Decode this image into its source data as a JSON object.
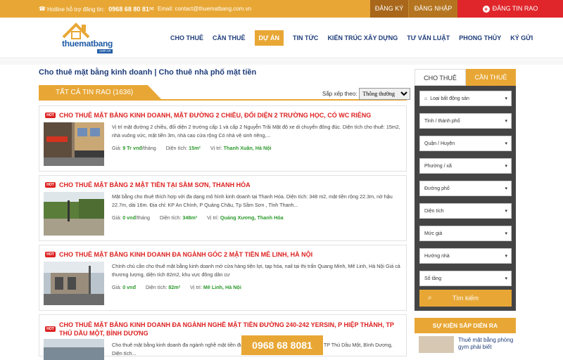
{
  "topbar": {
    "hotline_label": "Hotline hỗ trợ đăng tin:",
    "hotline_number": "0968 68 80 81",
    "email_label": "Email: contact@thuematbang.com.vn",
    "register": "ĐĂNG KÝ",
    "login": "ĐĂNG NHẬP",
    "post": "ĐĂNG TIN RAO"
  },
  "logo": {
    "word": "thuematbang",
    "domain": ".com.vn"
  },
  "nav": {
    "items": [
      "CHO THUÊ",
      "CẦN THUÊ",
      "DỰ ÁN",
      "TIN TỨC",
      "KIẾN TRÚC XÂY DỰNG",
      "TƯ VẤN LUẬT",
      "PHONG THỦY",
      "KÝ GỬI"
    ],
    "active_index": 2
  },
  "page": {
    "breadcrumb": "Cho thuê mặt bằng kinh doanh | Cho thuê nhà phố mặt tiền",
    "list_title": "TẤT CẢ TIN RAO (1636)",
    "sort_label": "Sắp xếp theo:",
    "sort_value": "Thông thường"
  },
  "listings": [
    {
      "title": "CHO THUÊ MẶT BẰNG KINH DOANH, MẶT ĐƯỜNG 2 CHIỀU, ĐỐI DIỆN 2 TRƯỜNG HỌC, CÓ WC RIÊNG",
      "desc": "Vị trí mặt đường 2 chiều, đối diện 2 trường cấp 1 và cấp 2 Nguyễn Trãi Mặt độ xe di chuyển đông đúc. Diện tích cho thuê: 15m2, nhà vuông vức, mặt tiền 3m, nhà cao cửa rộng Có nhà vệ sinh riêng,...",
      "price_label": "Giá:",
      "price": "9 Tr vnđ",
      "price_unit": "/tháng",
      "area_label": "Diện tích:",
      "area": "15m²",
      "loc_label": "Vị trí:",
      "loc": "Thanh Xuân, Hà Nội"
    },
    {
      "title": "CHO THUÊ MẶT BẰNG 2 MẶT TIỀN TẠI SẦM SƠN, THANH HÓA",
      "desc": "Mặt bằng cho thuê thích hợp với đa dạng mô hình kinh doanh tại Thanh Hóa. Diện tích: 348 m2, mặt tiền rộng 22.3m, nở hậu 22.7m, dài 16m. Địa chỉ: KP An Chính, P Quảng Châu, Tp Sầm Sơn , Tỉnh Thanh...",
      "price_label": "Giá:",
      "price": "0 vnđ",
      "price_unit": "/tháng",
      "area_label": "Diện tích:",
      "area": "348m²",
      "loc_label": "Vị trí:",
      "loc": "Quảng Xương, Thanh Hóa"
    },
    {
      "title": "CHO THUÊ MẶT BẰNG KINH DOANH ĐA NGÀNH GÓC 2 MẶT TIỀN MÊ LINH, HÀ NỘI",
      "desc": "Chính chủ cần cho thuê mặt bằng kinh doanh mở cửa hàng tiện lợi, tạp hóa, nail tại thị trấn Quang Minh, Mê Linh, Hà Nội Giá cả thương lượng, diện tích 82m2, khu vực đông dân cư",
      "price_label": "Giá:",
      "price": "0 vnđ",
      "price_unit": "",
      "area_label": "Diện tích:",
      "area": "82m²",
      "loc_label": "Vị trí:",
      "loc": "Mê Linh, Hà Nội"
    },
    {
      "title": "CHO THUÊ MẶT BẰNG KINH DOANH ĐA NGÀNH NGHỀ MẶT TIỀN ĐƯỜNG 240-242 YERSIN, P HIỆP THÀNH, TP THỦ DẦU MỘT, BÌNH DƯƠNG",
      "desc": "Cho thuê mặt bằng kinh doanh đa ngành nghề mặt tiền đường 240-242 Yersin, P Hiệp Thành, TP Thủ Dầu Một, Bình Dương, Diện tích..."
    }
  ],
  "sidebar": {
    "tab_rent": "CHO THUÊ",
    "tab_need": "CẦN THUÊ",
    "fields": [
      "Loại bất động sản",
      "Tỉnh / thành phố",
      "Quận / Huyện",
      "Phường / xã",
      "Đường phố",
      "Diện tích",
      "Mức giá",
      "Hướng nhà",
      "Số tầng"
    ],
    "search": "Tìm kiếm",
    "events_title": "SỰ KIỆN SẮP DIỄN RA",
    "event_text": "Thuê mặt bằng phòng gym phải biết"
  },
  "hotline_float": "0968 68 8081",
  "colors": {
    "accent": "#e8a735",
    "red": "#e0262b",
    "navy": "#1f3d7a",
    "green": "#2d9a2d"
  }
}
